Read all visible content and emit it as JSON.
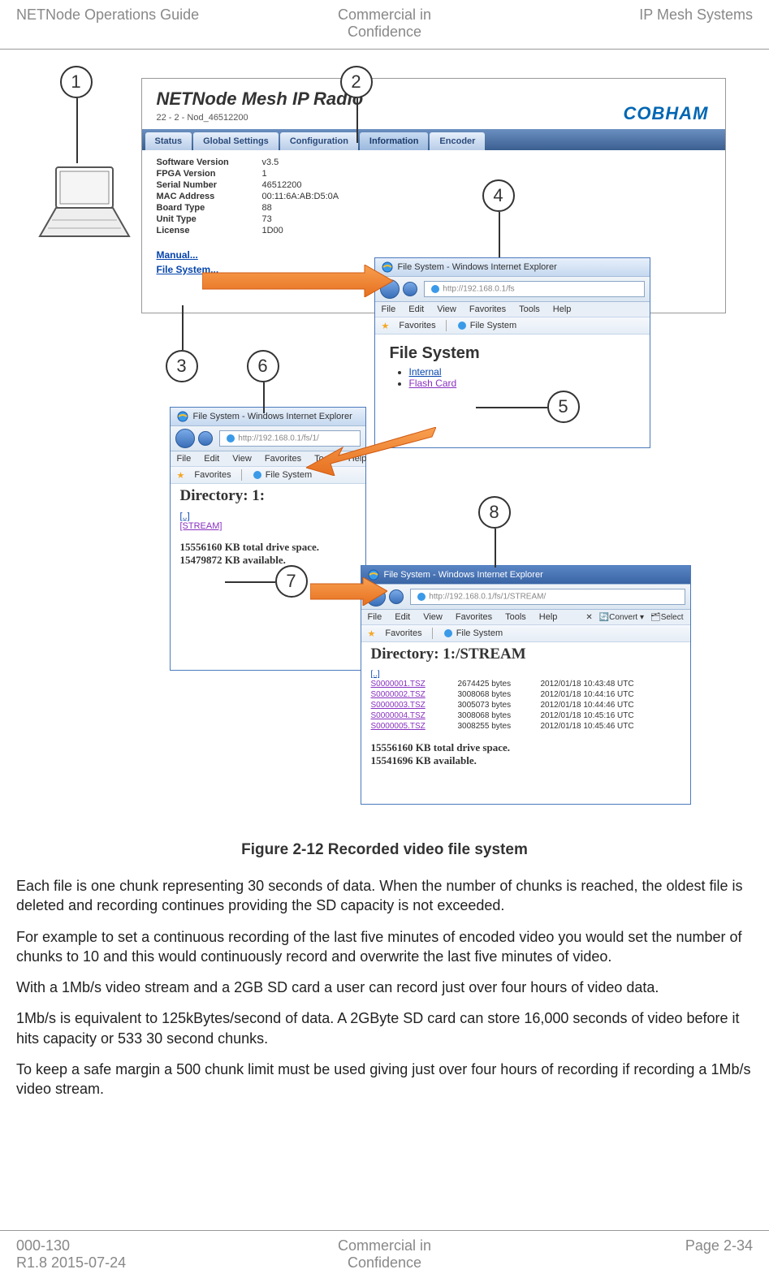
{
  "header": {
    "left": "NETNode Operations Guide",
    "center_l1": "Commercial in",
    "center_l2": "Confidence",
    "right": "IP Mesh Systems"
  },
  "footer": {
    "left_l1": "000-130",
    "left_l2": "R1.8 2015-07-24",
    "center_l1": "Commercial in",
    "center_l2": "Confidence",
    "right": "Page 2-34"
  },
  "callouts": {
    "c1": "1",
    "c2": "2",
    "c3": "3",
    "c4": "4",
    "c5": "5",
    "c6": "6",
    "c7": "7",
    "c8": "8"
  },
  "main_ui": {
    "title": "NETNode Mesh IP Radio",
    "node_id": "22 - 2 - Nod_46512200",
    "brand": "COBHAM",
    "tabs": {
      "status": "Status",
      "global": "Global Settings",
      "config": "Configuration",
      "info": "Information",
      "encoder": "Encoder"
    },
    "info": {
      "sw_label": "Software Version",
      "sw_value": "v3.5",
      "fpga_label": "FPGA Version",
      "fpga_value": "1",
      "serial_label": "Serial Number",
      "serial_value": "46512200",
      "mac_label": "MAC Address",
      "mac_value": "00:11:6A:AB:D5:0A",
      "board_label": "Board Type",
      "board_value": "88",
      "unit_label": "Unit Type",
      "unit_value": "73",
      "license_label": "License",
      "license_value": "1D00"
    },
    "links": {
      "manual": "Manual...",
      "filesystem": "File System..."
    }
  },
  "ie4": {
    "title": "File System - Windows Internet Explorer",
    "url": "http://192.168.0.1/fs",
    "menu": {
      "file": "File",
      "edit": "Edit",
      "view": "View",
      "fav": "Favorites",
      "tools": "Tools",
      "help": "Help"
    },
    "favorites": "Favorites",
    "tab_label": "File System",
    "heading": "File System",
    "links": {
      "internal": "Internal",
      "flash": "Flash Card"
    }
  },
  "ie6": {
    "title": "File System - Windows Internet Explorer",
    "url": "http://192.168.0.1/fs/1/",
    "menu": {
      "file": "File",
      "edit": "Edit",
      "view": "View",
      "fav": "Favorites",
      "tools": "Tools",
      "help": "Help"
    },
    "favorites": "Favorites",
    "tab_label": "File System",
    "heading": "Directory: 1:",
    "up": "[..]",
    "stream": "[STREAM]",
    "total": "15556160 KB total drive space.",
    "avail": "15479872 KB available."
  },
  "ie8": {
    "title": "File System - Windows Internet Explorer",
    "url": "http://192.168.0.1/fs/1/STREAM/",
    "menu": {
      "file": "File",
      "edit": "Edit",
      "view": "View",
      "fav": "Favorites",
      "tools": "Tools",
      "help": "Help"
    },
    "favorites": "Favorites",
    "tab_label": "File System",
    "convert": "Convert",
    "select": "Select",
    "heading": "Directory: 1:/STREAM",
    "up": "[..]",
    "files": [
      {
        "name": "S0000001.TSZ",
        "size": "2674425 bytes",
        "date": "2012/01/18 10:43:48 UTC"
      },
      {
        "name": "S0000002.TSZ",
        "size": "3008068 bytes",
        "date": "2012/01/18 10:44:16 UTC"
      },
      {
        "name": "S0000003.TSZ",
        "size": "3005073 bytes",
        "date": "2012/01/18 10:44:46 UTC"
      },
      {
        "name": "S0000004.TSZ",
        "size": "3008068 bytes",
        "date": "2012/01/18 10:45:16 UTC"
      },
      {
        "name": "S0000005.TSZ",
        "size": "3008255 bytes",
        "date": "2012/01/18 10:45:46 UTC"
      }
    ],
    "total": "15556160 KB total drive space.",
    "avail": "15541696 KB available."
  },
  "caption": "Figure 2-12 Recorded video file system",
  "para1": "Each file is one chunk representing 30 seconds of data. When the number of chunks is reached, the oldest file is deleted and recording continues providing the SD capacity is not exceeded.",
  "para2": "For example to set a continuous recording of the last five minutes of encoded video you would set the number of chunks to 10 and this would continuously record and overwrite the last five minutes of video.",
  "para3": "With a 1Mb/s video stream and a 2GB SD card a user can record just over four hours of video data.",
  "para4": "1Mb/s is equivalent to 125kBytes/second of data. A 2GByte SD card can store 16,000 seconds of video before it hits capacity or 533 30 second chunks.",
  "para5": "To keep a safe margin a 500 chunk limit must be used giving just over four hours of recording if recording a 1Mb/s video stream."
}
